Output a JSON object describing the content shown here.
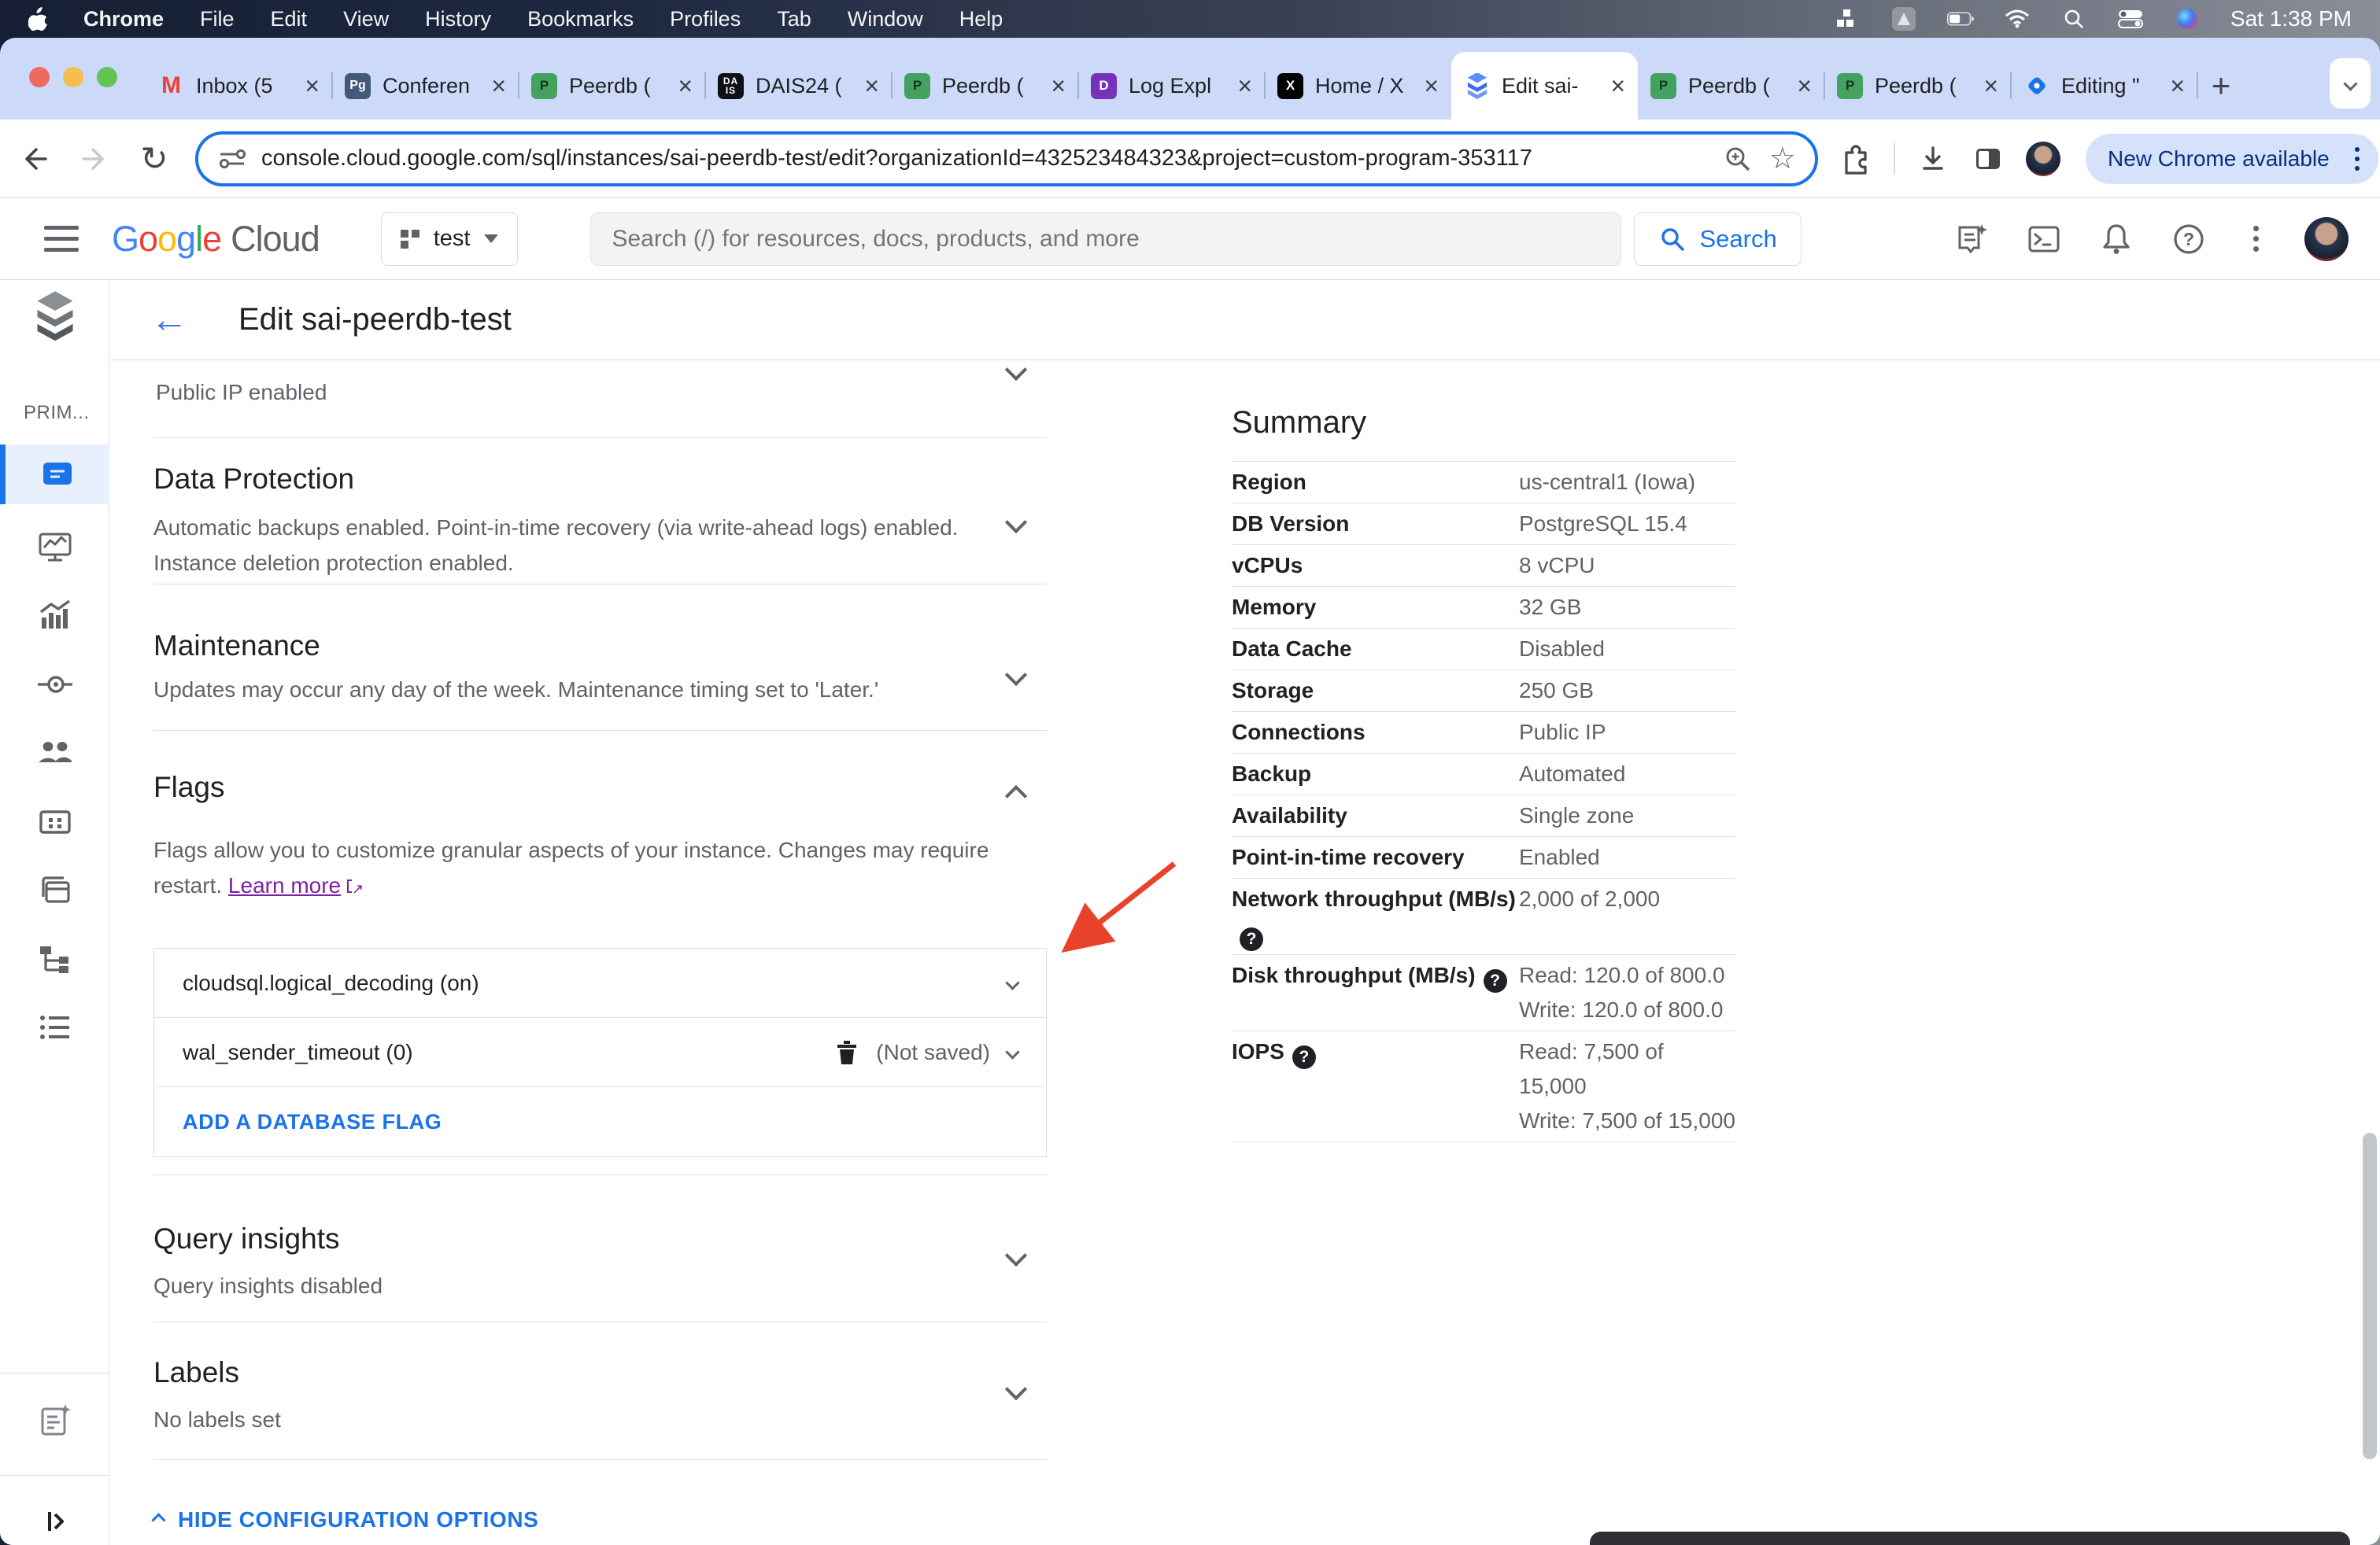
{
  "colors": {
    "accent_blue": "#1a73e8",
    "link_purple": "#7b1fa2",
    "annotation_red": "#e8432a",
    "update_pill_bg": "#d6e2fb",
    "tabstrip_bg": "#ccd9f8"
  },
  "menu_bar": {
    "items": [
      "Chrome",
      "File",
      "Edit",
      "View",
      "History",
      "Bookmarks",
      "Profiles",
      "Tab",
      "Window",
      "Help"
    ],
    "clock": "Sat 1:38 PM"
  },
  "tabs": [
    {
      "title": "Inbox (5",
      "favicon": "gmail"
    },
    {
      "title": "Conferen",
      "favicon": "postgresql"
    },
    {
      "title": "Peerdb (",
      "favicon": "peerdb"
    },
    {
      "title": "DAIS24 (",
      "favicon": "dais"
    },
    {
      "title": "Peerdb (",
      "favicon": "peerdb"
    },
    {
      "title": "Log Expl",
      "favicon": "datadog"
    },
    {
      "title": "Home / X",
      "favicon": "x"
    },
    {
      "title": "Edit sai-",
      "favicon": "cloud-sql",
      "active": true
    },
    {
      "title": "Peerdb (",
      "favicon": "peerdb"
    },
    {
      "title": "Peerdb (",
      "favicon": "peerdb"
    },
    {
      "title": "Editing \"",
      "favicon": "docs-pin"
    }
  ],
  "icon_glyphs": {
    "gmail": "M",
    "postgresql": "Pg",
    "peerdb": "P",
    "dais": "DA IS",
    "datadog": "D",
    "x": "X"
  },
  "browser": {
    "url": "console.cloud.google.com/sql/instances/sai-peerdb-test/edit?organizationId=432523484323&project=custom-program-353117",
    "update_pill": "New Chrome available"
  },
  "cloud_header": {
    "logo_google": "Google",
    "logo_cloud": "Cloud",
    "project_name": "test",
    "search_placeholder": "Search (/) for resources, docs, products, and more",
    "search_button": "Search"
  },
  "sidebar": {
    "section_label": "PRIM...",
    "icons": [
      "overview",
      "system-insights",
      "query-insights",
      "connections",
      "users",
      "databases",
      "backups",
      "replicas",
      "operations"
    ],
    "footer_icons": [
      "release-notes",
      "expand-panel"
    ]
  },
  "page": {
    "title": "Edit sai-peerdb-test",
    "public_ip": "Public IP enabled",
    "data_protection": {
      "title": "Data Protection",
      "line1": "Automatic backups enabled. Point-in-time recovery (via write-ahead logs) enabled.",
      "line2": "Instance deletion protection enabled."
    },
    "maintenance": {
      "title": "Maintenance",
      "body": "Updates may occur any day of the week. Maintenance timing set to 'Later.'"
    },
    "flags": {
      "title": "Flags",
      "body_line1": "Flags allow you to customize granular aspects of your instance. Changes may require",
      "body_line2": "restart.",
      "learn_more": "Learn more",
      "rows": [
        {
          "name": "cloudsql.logical_decoding (on)"
        },
        {
          "name": "wal_sender_timeout (0)",
          "badge": "(Not saved)"
        }
      ],
      "add_button": "ADD A DATABASE FLAG"
    },
    "query_insights": {
      "title": "Query insights",
      "body": "Query insights disabled"
    },
    "labels": {
      "title": "Labels",
      "body": "No labels set"
    },
    "hide_config": "HIDE CONFIGURATION OPTIONS"
  },
  "summary": {
    "title": "Summary",
    "rows": [
      {
        "label": "Region",
        "value": "us-central1 (Iowa)"
      },
      {
        "label": "DB Version",
        "value": "PostgreSQL 15.4"
      },
      {
        "label": "vCPUs",
        "value": "8 vCPU"
      },
      {
        "label": "Memory",
        "value": "32 GB"
      },
      {
        "label": "Data Cache",
        "value": "Disabled"
      },
      {
        "label": "Storage",
        "value": "250 GB"
      },
      {
        "label": "Connections",
        "value": "Public IP"
      },
      {
        "label": "Backup",
        "value": "Automated"
      },
      {
        "label": "Availability",
        "value": "Single zone"
      },
      {
        "label": "Point-in-time recovery",
        "value": "Enabled"
      },
      {
        "label": "Network throughput (MB/s)",
        "help": true,
        "value": "2,000 of 2,000"
      },
      {
        "label": "Disk throughput (MB/s)",
        "help": true,
        "value": "Read: 120.0 of 800.0",
        "value2": "Write: 120.0 of 800.0"
      },
      {
        "label": "IOPS",
        "help": true,
        "value": "Read: 7,500 of 15,000",
        "value2": "Write: 7,500 of 15,000"
      }
    ]
  }
}
